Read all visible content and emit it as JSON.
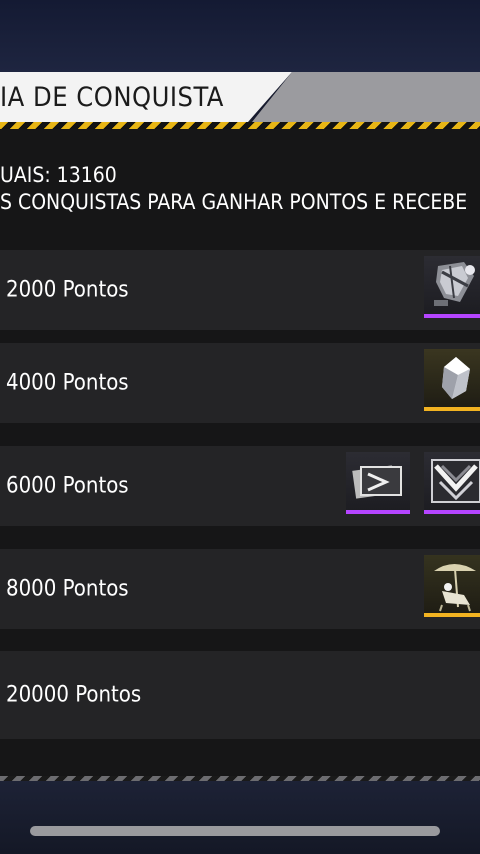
{
  "header": {
    "title": "IA DE CONQUISTA"
  },
  "info": {
    "points_line": "UAIS: 13160",
    "description_line": "S CONQUISTAS PARA GANHAR PONTOS E RECEBE"
  },
  "milestones": [
    {
      "label": "2000 Pontos",
      "rewards": [
        {
          "icon": "grenade-skin-icon",
          "rarity_color": "#b545ff"
        }
      ]
    },
    {
      "label": "4000 Pontos",
      "rewards": [
        {
          "icon": "crystal-token-icon",
          "rarity_color": "#f2b321"
        }
      ]
    },
    {
      "label": "6000 Pontos",
      "rewards": [
        {
          "icon": "card-pack-icon",
          "rarity_color": "#b545ff"
        },
        {
          "icon": "emblem-banner-icon",
          "rarity_color": "#b545ff"
        }
      ]
    },
    {
      "label": "8000 Pontos",
      "rewards": [
        {
          "icon": "beach-chair-emote-icon",
          "rarity_color": "#f2b321"
        }
      ]
    },
    {
      "label": "20000 Pontos",
      "rewards": []
    }
  ],
  "colors": {
    "accent_yellow": "#e7b515",
    "rarity_purple": "#b545ff",
    "rarity_gold": "#f2b321"
  }
}
